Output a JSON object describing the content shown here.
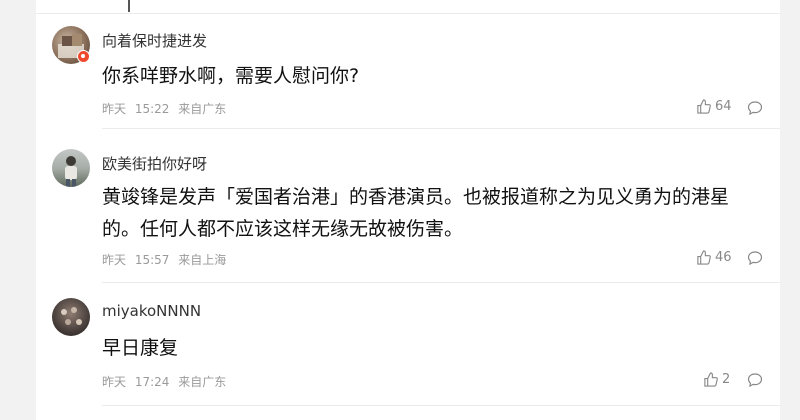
{
  "comments": [
    {
      "username": "向着保时捷进发",
      "text": "你系咩野水啊，需要人慰问你?",
      "date": "昨天",
      "time": "15:22",
      "location": "来自广东",
      "likes": "64"
    },
    {
      "username": "欧美街拍你好呀",
      "text": "黄竣锋是发声「爱国者治港」的香港演员。也被报道称之为见义勇为的港星的。任何人都不应该这样无缘无故被伤害。",
      "date": "昨天",
      "time": "15:57",
      "location": "来自上海",
      "likes": "46"
    },
    {
      "username": "miyakoNNNN",
      "text": "早日康复",
      "date": "昨天",
      "time": "17:24",
      "location": "来自广东",
      "likes": "2"
    }
  ],
  "icons": {
    "like": "thumbs-up-icon",
    "reply": "comment-bubble-icon",
    "badge": "verified-badge-icon"
  },
  "colors": {
    "badge": "#f04a2e",
    "meta_text": "#9a9a9a"
  }
}
